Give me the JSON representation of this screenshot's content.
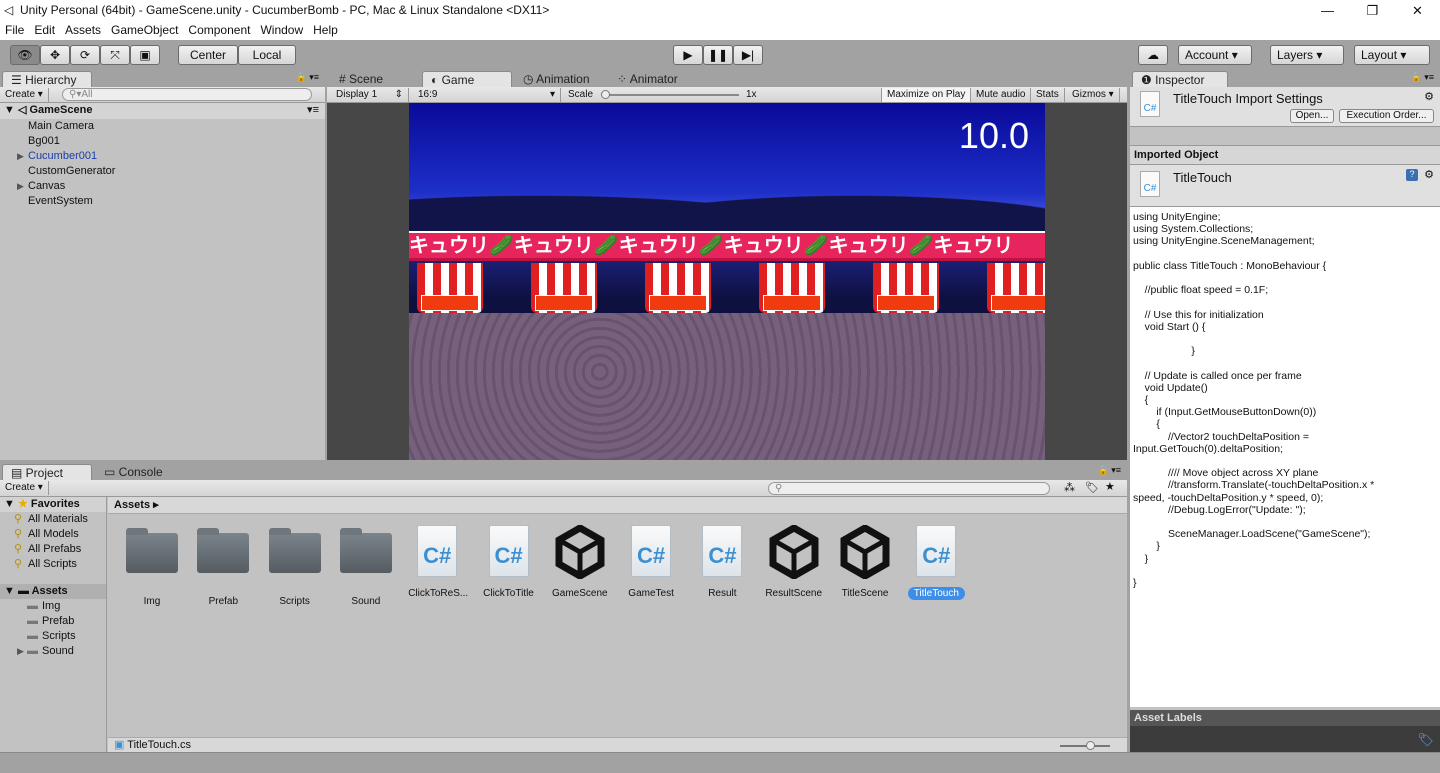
{
  "window": {
    "title": "Unity Personal (64bit) - GameScene.unity - CucumberBomb - PC, Mac & Linux Standalone <DX11>",
    "minimize": "—",
    "maximize": "❐",
    "close": "✕"
  },
  "menu": [
    "File",
    "Edit",
    "Assets",
    "GameObject",
    "Component",
    "Window",
    "Help"
  ],
  "toolbar": {
    "tools": [
      "hand-tool",
      "move-tool",
      "rotate-tool",
      "scale-tool",
      "rect-tool"
    ],
    "pivot": "Center",
    "space": "Local",
    "account": "Account",
    "layers": "Layers",
    "layout": "Layout"
  },
  "hierarchy": {
    "tab": "Hierarchy",
    "create": "Create",
    "search_placeholder": "All",
    "scene": "GameScene",
    "items": [
      {
        "label": "Main Camera",
        "expandable": false,
        "prefab": false
      },
      {
        "label": "Bg001",
        "expandable": false,
        "prefab": false
      },
      {
        "label": "Cucumber001",
        "expandable": true,
        "prefab": true
      },
      {
        "label": "CustomGenerator",
        "expandable": false,
        "prefab": false
      },
      {
        "label": "Canvas",
        "expandable": true,
        "prefab": false
      },
      {
        "label": "EventSystem",
        "expandable": false,
        "prefab": false
      }
    ]
  },
  "center_tabs": [
    "Scene",
    "Game",
    "Animation",
    "Animator"
  ],
  "game": {
    "display": "Display 1",
    "aspect": "16:9",
    "scale_label": "Scale",
    "scale_value": "1x",
    "maximize": "Maximize on Play",
    "mute": "Mute audio",
    "stats": "Stats",
    "gizmos": "Gizmos",
    "timer": "10.0",
    "banner": "キュウリ🥒キュウリ🥒キュウリ🥒キュウリ🥒キュウリ🥒キュウリ"
  },
  "project": {
    "tabs": [
      "Project",
      "Console"
    ],
    "create": "Create",
    "breadcrumb": "Assets",
    "favorites_label": "Favorites",
    "favorites": [
      "All Materials",
      "All Models",
      "All Prefabs",
      "All Scripts"
    ],
    "assets_label": "Assets",
    "folders": [
      "Img",
      "Prefab",
      "Scripts",
      "Sound"
    ],
    "items": [
      {
        "label": "Img",
        "type": "folder"
      },
      {
        "label": "Prefab",
        "type": "folder"
      },
      {
        "label": "Scripts",
        "type": "folder"
      },
      {
        "label": "Sound",
        "type": "folder"
      },
      {
        "label": "ClickToReS...",
        "type": "script"
      },
      {
        "label": "ClickToTitle",
        "type": "script"
      },
      {
        "label": "GameScene",
        "type": "scene"
      },
      {
        "label": "GameTest",
        "type": "script"
      },
      {
        "label": "Result",
        "type": "script"
      },
      {
        "label": "ResultScene",
        "type": "scene"
      },
      {
        "label": "TitleScene",
        "type": "scene"
      },
      {
        "label": "TitleTouch",
        "type": "script",
        "selected": true
      }
    ],
    "footer_file": "TitleTouch.cs"
  },
  "inspector": {
    "tab": "Inspector",
    "title": "TitleTouch Import Settings",
    "open": "Open...",
    "exec_order": "Execution Order...",
    "imported_header": "Imported Object",
    "object_name": "TitleTouch",
    "asset_labels": "Asset Labels",
    "code": "using UnityEngine;\nusing System.Collections;\nusing UnityEngine.SceneManagement;\n\npublic class TitleTouch : MonoBehaviour {\n\n    //public float speed = 0.1F;\n\n    // Use this for initialization\n    void Start () {\n\n                    }\n\n    // Update is called once per frame\n    void Update()\n    {\n        if (Input.GetMouseButtonDown(0))\n        {\n            //Vector2 touchDeltaPosition =\nInput.GetTouch(0).deltaPosition;\n\n            //// Move object across XY plane\n            //transform.Translate(-touchDeltaPosition.x *\nspeed, -touchDeltaPosition.y * speed, 0);\n            //Debug.LogError(\"Update: \");\n\n            SceneManager.LoadScene(\"GameScene\");\n        }\n    }\n\n}"
  },
  "colors": {
    "selection": "#3d8ee8",
    "prefab_text": "#1a3fa8",
    "sky_top": "#0a0a9a",
    "ground": "#6d5a78"
  }
}
